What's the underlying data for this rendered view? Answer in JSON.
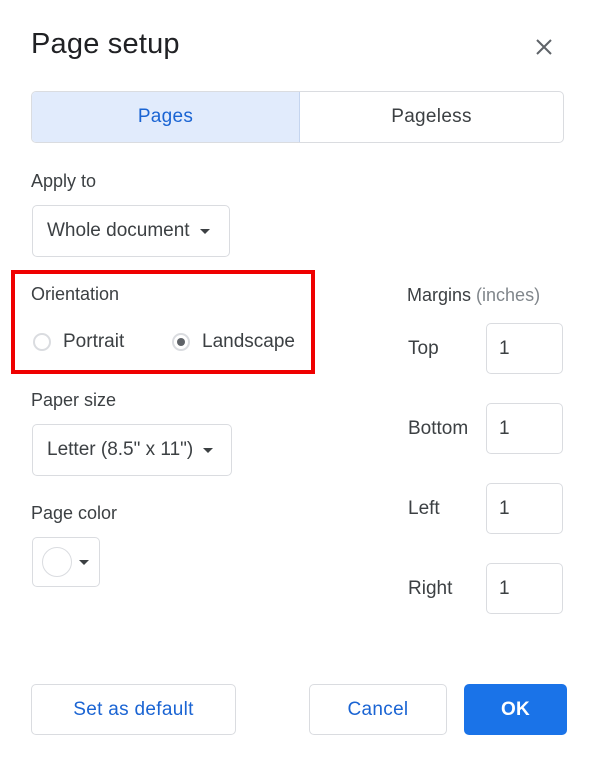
{
  "dialog": {
    "title": "Page setup",
    "close_icon": "close-icon"
  },
  "tabs": [
    {
      "label": "Pages",
      "active": true
    },
    {
      "label": "Pageless",
      "active": false
    }
  ],
  "apply_to": {
    "label": "Apply to",
    "value": "Whole document"
  },
  "orientation": {
    "label": "Orientation",
    "options": [
      {
        "label": "Portrait",
        "selected": false
      },
      {
        "label": "Landscape",
        "selected": true
      }
    ],
    "highlight_color": "#ef0000"
  },
  "paper_size": {
    "label": "Paper size",
    "value": "Letter (8.5\" x 11\")"
  },
  "page_color": {
    "label": "Page color",
    "value": "#ffffff"
  },
  "margins": {
    "label": "Margins",
    "unit": "(inches)",
    "fields": [
      {
        "label": "Top",
        "value": "1"
      },
      {
        "label": "Bottom",
        "value": "1"
      },
      {
        "label": "Left",
        "value": "1"
      },
      {
        "label": "Right",
        "value": "1"
      }
    ]
  },
  "buttons": {
    "set_default": "Set as default",
    "cancel": "Cancel",
    "ok": "OK"
  },
  "colors": {
    "accent": "#1a73e8",
    "active_tab_bg": "#e1ebfc"
  }
}
